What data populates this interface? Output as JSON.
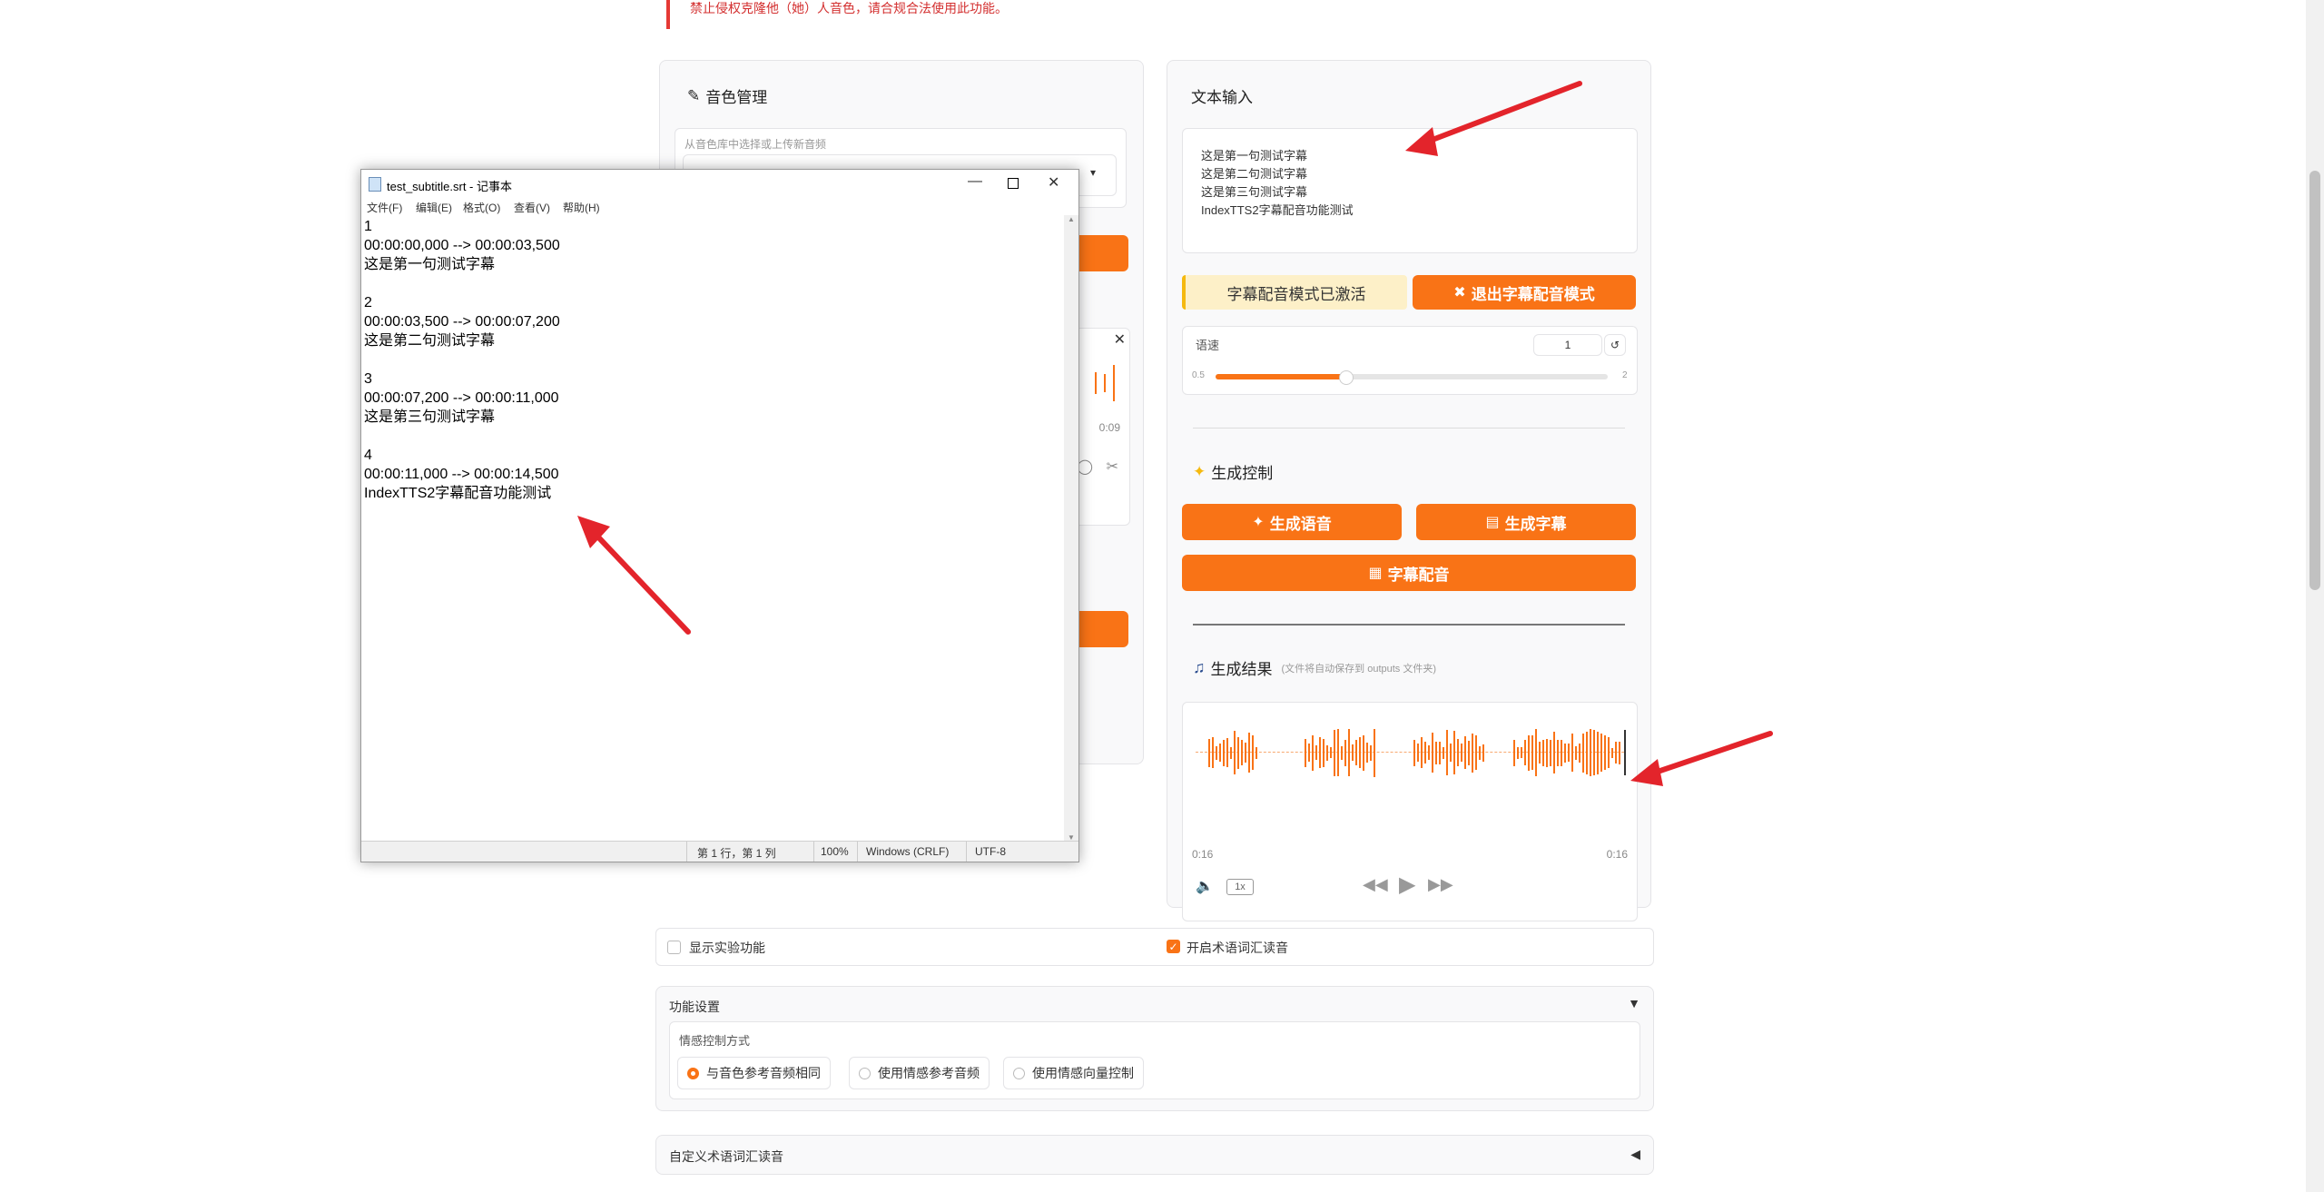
{
  "notice": "禁止侵权克隆他（她）人音色，请合规合法使用此功能。",
  "voice_panel": {
    "title": "音色管理",
    "select_label": "从音色库中选择或上传新音频",
    "time_end": "0:09"
  },
  "text_panel": {
    "title": "文本输入",
    "text_lines": [
      "这是第一句测试字幕",
      "这是第二句测试字幕",
      "这是第三句测试字幕",
      "IndexTTS2字幕配音功能测试"
    ],
    "subtitle_mode_active": "字幕配音模式已激活",
    "exit_subtitle_mode": "退出字幕配音模式",
    "speed_label": "语速",
    "speed_value": "1",
    "speed_min": "0.5",
    "speed_max": "2",
    "speed_fraction": 0.33
  },
  "generate": {
    "title": "生成控制",
    "btn_speech": "生成语音",
    "btn_subtitle": "生成字幕",
    "btn_dubbing": "字幕配音"
  },
  "result": {
    "title": "生成结果",
    "note": "(文件将自动保存到 outputs 文件夹)",
    "time_start": "0:16",
    "time_end": "0:16",
    "speed": "1x"
  },
  "options": {
    "show_experimental": "显示实验功能",
    "enable_glossary": "开启术语词汇读音"
  },
  "settings": {
    "title": "功能设置",
    "emotion_label": "情感控制方式",
    "emotion_options": [
      "与音色参考音频相同",
      "使用情感参考音频",
      "使用情感向量控制"
    ],
    "custom_glossary": "自定义术语词汇读音"
  },
  "notepad": {
    "title": "test_subtitle.srt - 记事本",
    "menu": [
      "文件(F)",
      "编辑(E)",
      "格式(O)",
      "查看(V)",
      "帮助(H)"
    ],
    "content": "1\n00:00:00,000 --> 00:00:03,500\n这是第一句测试字幕\n\n2\n00:00:03,500 --> 00:00:07,200\n这是第二句测试字幕\n\n3\n00:00:07,200 --> 00:00:11,000\n这是第三句测试字幕\n\n4\n00:00:11,000 --> 00:00:14,500\nIndexTTS2字幕配音功能测试",
    "status_pos": "第 1 行，第 1 列",
    "status_zoom": "100%",
    "status_eol": "Windows (CRLF)",
    "status_enc": "UTF-8"
  },
  "colors": {
    "accent": "#f97316",
    "arrow": "#e3242b",
    "active_bg": "#fdf0c8"
  }
}
